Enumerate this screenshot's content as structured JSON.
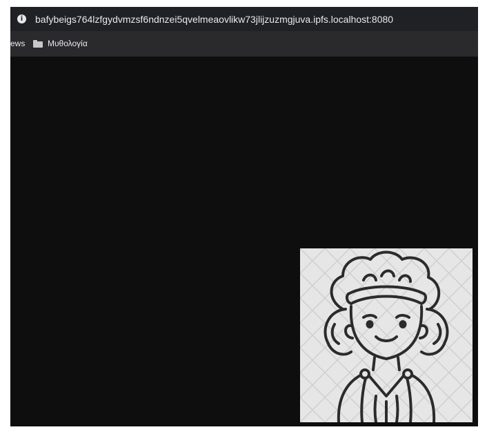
{
  "address_bar": {
    "url": "bafybeigs764lzfgydvmzsf6ndnzei5qvelmeaovlikw73jlijzuzmgjuva.ipfs.localhost:8080",
    "info_icon": "info-icon"
  },
  "bookmarks": {
    "partial_label": "ews",
    "folder_label": "Μυθολογία",
    "folder_icon": "folder-icon"
  },
  "content": {
    "image": "woman-avatar-illustration"
  }
}
